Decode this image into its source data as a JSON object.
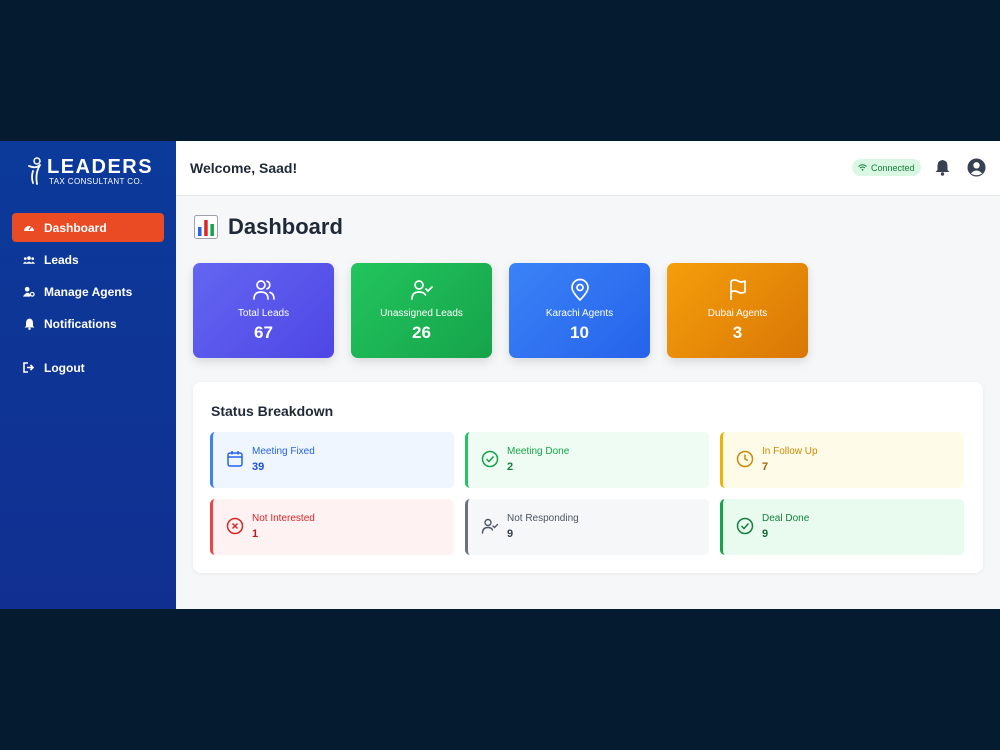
{
  "brand": {
    "name": "LEADERS",
    "tagline": "TAX CONSULTANT CO."
  },
  "sidebar": {
    "items": [
      {
        "label": "Dashboard",
        "icon": "gauge-icon",
        "active": true
      },
      {
        "label": "Leads",
        "icon": "users-icon"
      },
      {
        "label": "Manage Agents",
        "icon": "user-gear-icon"
      },
      {
        "label": "Notifications",
        "icon": "bell-icon"
      },
      {
        "label": "Logout",
        "icon": "logout-icon"
      }
    ]
  },
  "header": {
    "welcome": "Welcome, Saad!",
    "status": "Connected"
  },
  "page": {
    "title": "Dashboard"
  },
  "stats": [
    {
      "label": "Total Leads",
      "value": "67",
      "icon": "users-icon",
      "color": "#5b50e6"
    },
    {
      "label": "Unassigned Leads",
      "value": "26",
      "icon": "user-check-icon",
      "color": "#22a94b"
    },
    {
      "label": "Karachi Agents",
      "value": "10",
      "icon": "map-pin-icon",
      "color": "#3b6ff0"
    },
    {
      "label": "Dubai Agents",
      "value": "3",
      "icon": "flag-icon",
      "color": "#ef8a09"
    }
  ],
  "breakdown": {
    "title": "Status Breakdown",
    "items": [
      {
        "label": "Meeting Fixed",
        "value": "39",
        "icon": "calendar-icon",
        "color": "#2563eb"
      },
      {
        "label": "Meeting Done",
        "value": "2",
        "icon": "check-circle-icon",
        "color": "#16a34a"
      },
      {
        "label": "In Follow Up",
        "value": "7",
        "icon": "clock-icon",
        "color": "#ca8a04"
      },
      {
        "label": "Not Interested",
        "value": "1",
        "icon": "x-circle-icon",
        "color": "#dc2626"
      },
      {
        "label": "Not Responding",
        "value": "9",
        "icon": "user-check-icon",
        "color": "#4b5563"
      },
      {
        "label": "Deal Done",
        "value": "9",
        "icon": "check-circle-icon",
        "color": "#15803d"
      }
    ]
  }
}
